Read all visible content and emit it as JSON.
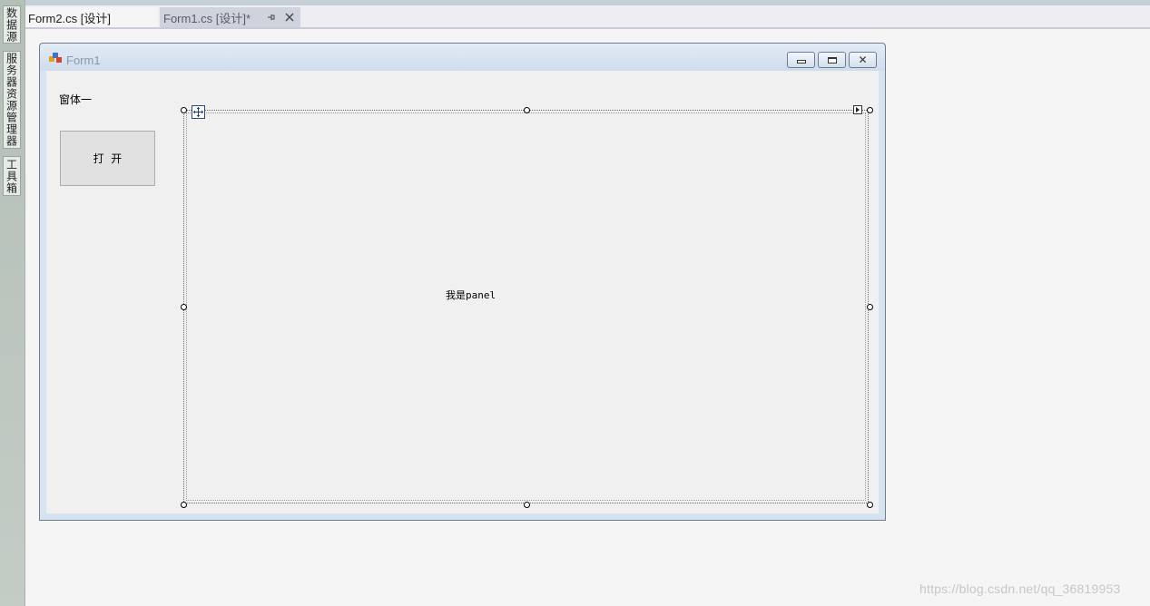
{
  "side_strip": {
    "tabs": [
      "数据源",
      "服务器资源管理器",
      "工具箱"
    ]
  },
  "tabs": [
    {
      "label": "Form2.cs [设计]",
      "active": true
    },
    {
      "label": "Form1.cs [设计]*",
      "active": false
    }
  ],
  "tab_icons": {
    "pin": "pin-icon",
    "close": "close-icon"
  },
  "form": {
    "title": "Form1",
    "caption_buttons": [
      "minimize-icon",
      "maximize-icon",
      "close-icon"
    ],
    "label": "窗体一",
    "button_label": "打  开",
    "panel_text": "我是panel"
  },
  "watermark": "https://blog.csdn.net/qq_36819953",
  "colors": {
    "accent": "#c9cbd6",
    "form_frame": "#d6e3f1",
    "client_bg": "#f0f0f0"
  }
}
